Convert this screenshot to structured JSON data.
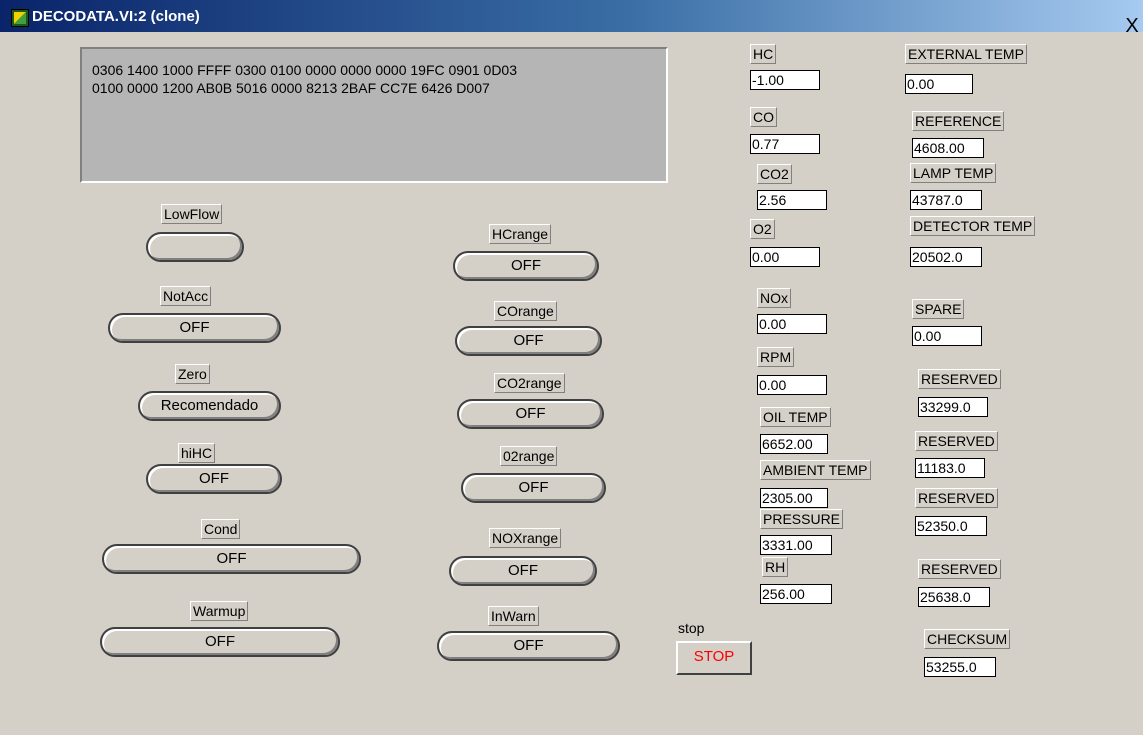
{
  "window": {
    "title": "DECODATA.VI:2 (clone)",
    "close_glyph": "X"
  },
  "hex_display": "0306 1400 1000 FFFF 0300 0100 0000 0000 0000 19FC 0901 0D03\n0100 0000 1200 AB0B 5016 0000 8213 2BAF CC7E 6426 D007",
  "left_indicators": [
    {
      "label": "LowFlow",
      "value": ""
    },
    {
      "label": "NotAcc",
      "value": "OFF"
    },
    {
      "label": "Zero",
      "value": "Recomendado"
    },
    {
      "label": "hiHC",
      "value": "OFF"
    },
    {
      "label": "Cond",
      "value": "OFF"
    },
    {
      "label": "Warmup",
      "value": "OFF"
    }
  ],
  "range_indicators": [
    {
      "label": "HCrange",
      "value": "OFF"
    },
    {
      "label": "COrange",
      "value": "OFF"
    },
    {
      "label": "CO2range",
      "value": "OFF"
    },
    {
      "label": "02range",
      "value": "OFF"
    },
    {
      "label": "NOXrange",
      "value": "OFF"
    },
    {
      "label": "InWarn",
      "value": "OFF"
    }
  ],
  "gas_readings": [
    {
      "label": "HC",
      "value": "-1.00"
    },
    {
      "label": "CO",
      "value": "0.77"
    },
    {
      "label": "CO2",
      "value": "2.56"
    },
    {
      "label": "O2",
      "value": "0.00"
    },
    {
      "label": "NOx",
      "value": "0.00"
    },
    {
      "label": "RPM",
      "value": "0.00"
    },
    {
      "label": "OIL TEMP",
      "value": "6652.00"
    },
    {
      "label": "AMBIENT TEMP",
      "value": "2305.00"
    },
    {
      "label": "PRESSURE",
      "value": "3331.00"
    },
    {
      "label": "RH",
      "value": "256.00"
    }
  ],
  "sensor_readings": [
    {
      "label": "EXTERNAL TEMP",
      "value": "0.00"
    },
    {
      "label": "REFERENCE",
      "value": "4608.00"
    },
    {
      "label": "LAMP TEMP",
      "value": "43787.0"
    },
    {
      "label": "DETECTOR TEMP",
      "value": "20502.0"
    },
    {
      "label": "SPARE",
      "value": "0.00"
    },
    {
      "label": "RESERVED",
      "value": "33299.0"
    },
    {
      "label": "RESERVED",
      "value": "11183.0"
    },
    {
      "label": "RESERVED",
      "value": "52350.0"
    },
    {
      "label": "RESERVED",
      "value": "25638.0"
    },
    {
      "label": "CHECKSUM",
      "value": "53255.0"
    }
  ],
  "stop_control": {
    "label": "stop",
    "button": "STOP"
  }
}
